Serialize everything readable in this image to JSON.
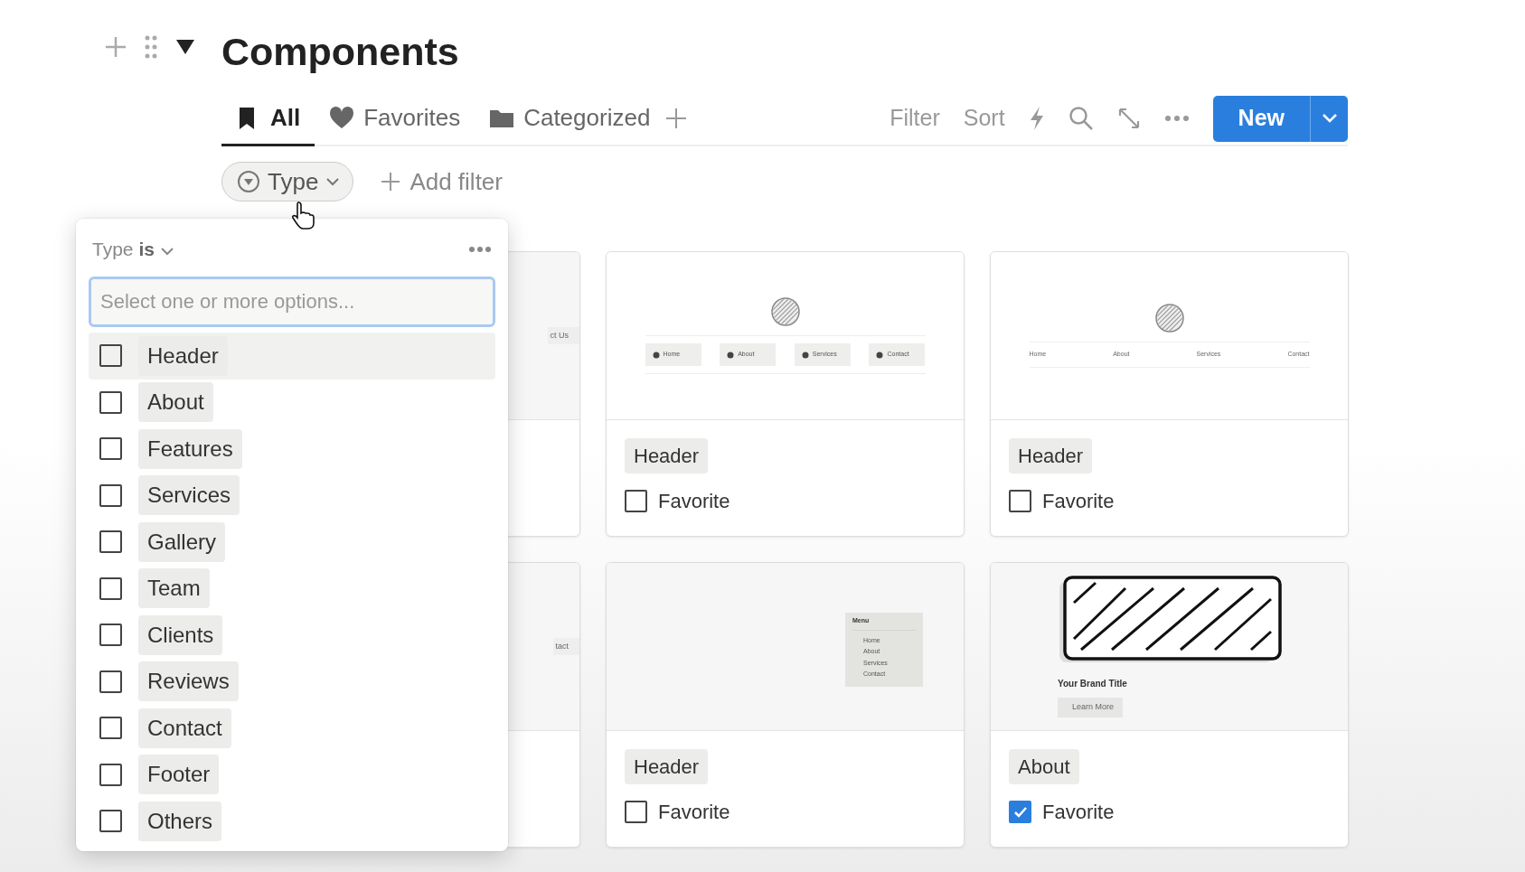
{
  "header": {
    "title": "Components",
    "expanded": true
  },
  "tabs": [
    {
      "label": "All",
      "selected": true
    },
    {
      "label": "Favorites",
      "selected": false
    },
    {
      "label": "Categorized",
      "selected": false
    }
  ],
  "toolbar": {
    "filter": "Filter",
    "sort": "Sort",
    "new_button": "New"
  },
  "filter_chip": {
    "label": "Type"
  },
  "add_filter": "Add filter",
  "dropdown": {
    "property": "Type",
    "operator": "is",
    "placeholder": "Select one or more options...",
    "options": [
      {
        "label": "Header",
        "checked": false
      },
      {
        "label": "About",
        "checked": false
      },
      {
        "label": "Features",
        "checked": false
      },
      {
        "label": "Services",
        "checked": false
      },
      {
        "label": "Gallery",
        "checked": false
      },
      {
        "label": "Team",
        "checked": false
      },
      {
        "label": "Clients",
        "checked": false
      },
      {
        "label": "Reviews",
        "checked": false
      },
      {
        "label": "Contact",
        "checked": false
      },
      {
        "label": "Footer",
        "checked": false
      },
      {
        "label": "Others",
        "checked": false
      }
    ]
  },
  "cards": [
    {
      "preview": {
        "kind": "partial",
        "text": "ct Us"
      }
    },
    {
      "preview": {
        "kind": "nav-buttons",
        "items": [
          "Home",
          "About",
          "Services",
          "Contact"
        ]
      },
      "tag": "Header",
      "favorite_label": "Favorite",
      "favorite": false
    },
    {
      "preview": {
        "kind": "nav-plain",
        "items": [
          "Home",
          "About",
          "Services",
          "Contact"
        ]
      },
      "tag": "Header",
      "favorite_label": "Favorite",
      "favorite": false
    },
    {
      "preview": {
        "kind": "partial",
        "text": "tact"
      }
    },
    {
      "preview": {
        "kind": "menu",
        "title": "Menu",
        "items": [
          "Home",
          "About",
          "Services",
          "Contact"
        ]
      },
      "tag": "Header",
      "favorite_label": "Favorite",
      "favorite": false
    },
    {
      "preview": {
        "kind": "hero",
        "title": "Your Brand Title",
        "button": "Learn More"
      },
      "tag": "About",
      "favorite_label": "Favorite",
      "favorite": true
    }
  ]
}
